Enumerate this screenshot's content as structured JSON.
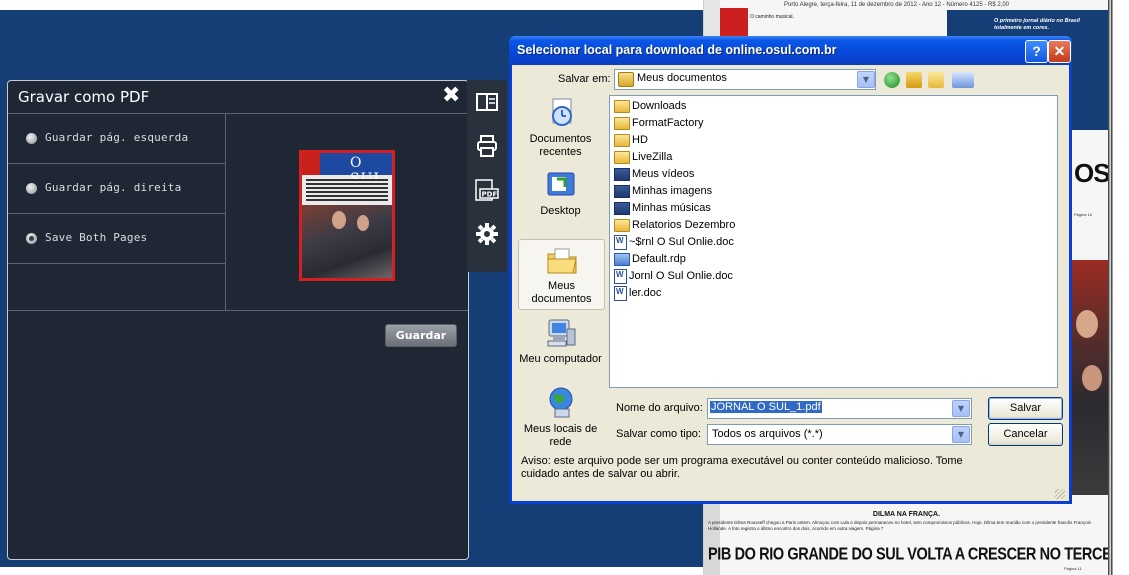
{
  "newspaper": {
    "dateline": "Porto Alegre, terça-feira, 11 de dezembro de 2012 - Ano 12 - Número 4125 - R$ 2,00",
    "header_tagline": "O primeiro jornal diário no Brasil totalmente em cores.",
    "corner_text": "O caminho musical,",
    "big_letters": "OS",
    "page_ref": "Página 16",
    "photo_caption_head": "DILMA NA FRANÇA.",
    "photo_caption": "A presidente Dilma Rousseff chegou a Paris ontem. Almoçou com Lula e depois permaneceu no hotel, sem compromissos públicos. Hoje, Dilma tem reunião com o presidente francês François Hollande. A foto registra o último encontro dos dois, ocorrido em outra viagem. Página 7",
    "headline": "PIB DO RIO GRANDE DO SUL VOLTA A CRESCER NO TERCEIRO TRIMESTRE.",
    "headline_page": "Página 11"
  },
  "pdf_panel": {
    "title": "Gravar como PDF",
    "close_symbol": "✖",
    "options": [
      {
        "label": "Guardar pág. esquerda",
        "selected": false
      },
      {
        "label": "Guardar pág. direita",
        "selected": false
      },
      {
        "label": "Save Both Pages",
        "selected": true
      }
    ],
    "thumbnail_logo": "O SUL",
    "save_button": "Guardar"
  },
  "side_tabs": [
    "pages-icon",
    "printer-icon",
    "pdf-icon",
    "settings-icon"
  ],
  "side_tabs_pdf_text": "PDF",
  "dialog": {
    "title": "Selecionar local para download de online.osul.com.br",
    "help_symbol": "?",
    "close_symbol": "✕",
    "save_in_label": "Salvar em:",
    "save_in_value": "Meus documentos",
    "places": [
      "Documentos recentes",
      "Desktop",
      "Meus documentos",
      "Meu computador",
      "Meus locais de rede"
    ],
    "files": [
      {
        "name": "Downloads",
        "icon": "folder"
      },
      {
        "name": "FormatFactory",
        "icon": "folder"
      },
      {
        "name": "HD",
        "icon": "folder"
      },
      {
        "name": "LiveZilla",
        "icon": "folder"
      },
      {
        "name": "Meus vídeos",
        "icon": "media"
      },
      {
        "name": "Minhas imagens",
        "icon": "media"
      },
      {
        "name": "Minhas músicas",
        "icon": "media"
      },
      {
        "name": "Relatorios Dezembro",
        "icon": "folder"
      },
      {
        "name": "~$rnl O Sul Onlie.doc",
        "icon": "doc"
      },
      {
        "name": "Default.rdp",
        "icon": "rdp"
      },
      {
        "name": "Jornl O Sul Onlie.doc",
        "icon": "doc"
      },
      {
        "name": "ler.doc",
        "icon": "doc"
      }
    ],
    "file_name_label": "Nome do arquivo:",
    "file_name_value": "JORNAL O SUL_1.pdf",
    "file_type_label": "Salvar como tipo:",
    "file_type_value": "Todos os arquivos (*.*)",
    "save_button": "Salvar",
    "cancel_button": "Cancelar",
    "warning": "Aviso: este arquivo pode ser um programa executável ou conter conteúdo malicioso. Tome cuidado antes de salvar ou abrir."
  },
  "colors": {
    "site_blue": "#153e77",
    "panel_bg": "#1e2733",
    "xp_title_blue": "#0a58e8",
    "xp_face": "#ece9d8",
    "selection_blue": "#316ac5",
    "thumb_border": "#d42020"
  }
}
